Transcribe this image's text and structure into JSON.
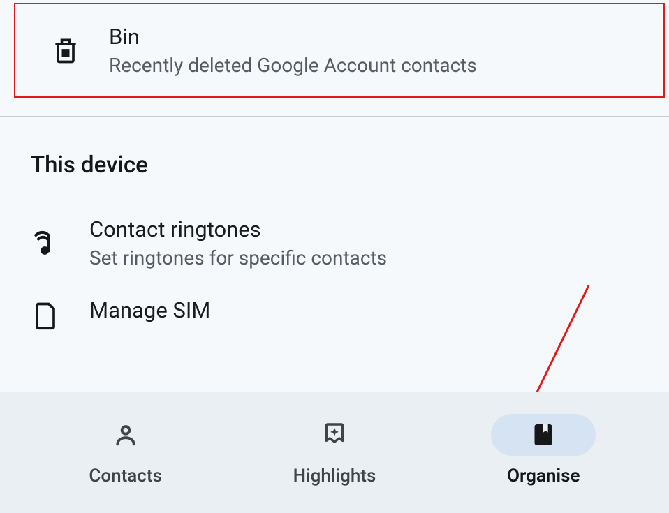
{
  "bin": {
    "title": "Bin",
    "subtitle": "Recently deleted Google Account contacts"
  },
  "section": {
    "header": "This device"
  },
  "ringtones": {
    "title": "Contact ringtones",
    "subtitle": "Set ringtones for specific contacts"
  },
  "sim": {
    "title": "Manage SIM"
  },
  "nav": {
    "contacts": "Contacts",
    "highlights": "Highlights",
    "organise": "Organise"
  }
}
